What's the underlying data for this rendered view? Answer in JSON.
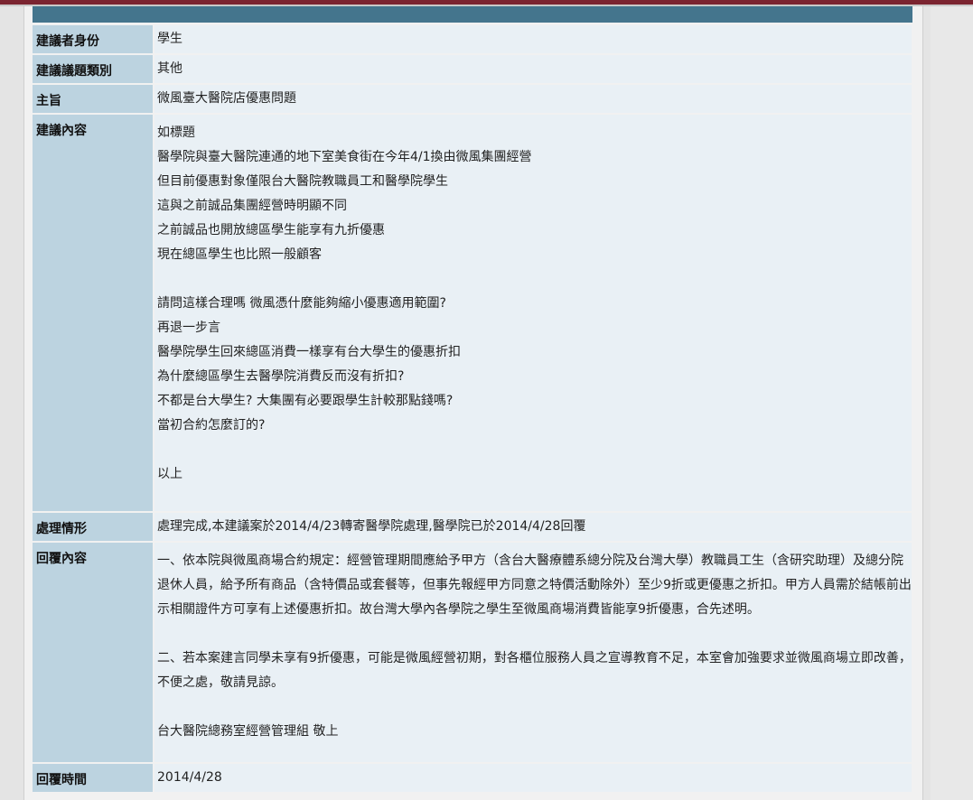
{
  "fields": {
    "identity": {
      "label": "建議者身份",
      "value": "學生"
    },
    "category": {
      "label": "建議議題類別",
      "value": "其他"
    },
    "subject": {
      "label": "主旨",
      "value": "微風臺大醫院店優惠問題"
    },
    "content": {
      "label": "建議內容",
      "lines": [
        "如標題",
        "醫學院與臺大醫院連通的地下室美食街在今年4/1換由微風集團經營",
        "但目前優惠對象僅限台大醫院教職員工和醫學院學生",
        "這與之前誠品集團經營時明顯不同",
        "之前誠品也開放總區學生能享有九折優惠",
        "現在總區學生也比照一般顧客",
        "",
        "請問這樣合理嗎 微風憑什麼能夠縮小優惠適用範圍?",
        "再退一步言",
        "醫學院學生回來總區消費一樣享有台大學生的優惠折扣",
        "為什麼總區學生去醫學院消費反而沒有折扣?",
        "不都是台大學生? 大集團有必要跟學生計較那點錢嗎?",
        "當初合約怎麼訂的?",
        "",
        "以上"
      ]
    },
    "status": {
      "label": "處理情形",
      "value": "處理完成,本建議案於2014/4/23轉寄醫學院處理,醫學院已於2014/4/28回覆"
    },
    "reply": {
      "label": "回覆內容",
      "para1": "一、依本院與微風商場合約規定：經營管理期間應給予甲方（含台大醫療體系總分院及台灣大學）教職員工生（含研究助理）及總分院退休人員，給予所有商品（含特價品或套餐等，但事先報經甲方同意之特價活動除外）至少9折或更優惠之折扣。甲方人員需於結帳前出示相關證件方可享有上述優惠折扣。故台灣大學內各學院之學生至微風商場消費皆能享9折優惠，合先述明。",
      "para2": "二、若本案建言同學未享有9折優惠，可能是微風經營初期，對各櫃位服務人員之宣導教育不足，本室會加強要求並微風商場立即改善，不便之處，敬請見諒。",
      "signature": "台大醫院總務室經營管理組 敬上"
    },
    "reply_time": {
      "label": "回覆時間",
      "value": "2014/4/28"
    }
  },
  "colors": {
    "header_bar": "#44758d",
    "label_cell": "#bcd3e0",
    "value_cell": "#e9f0f5",
    "top_bar": "#7b2430"
  }
}
